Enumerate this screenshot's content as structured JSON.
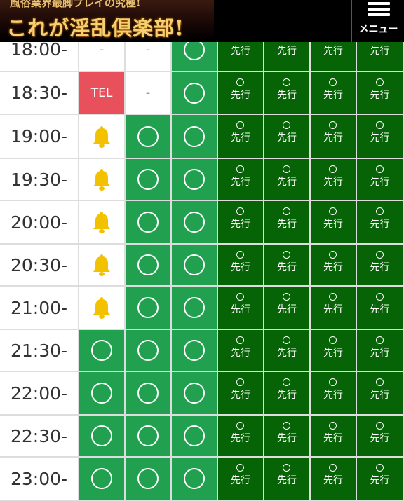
{
  "header": {
    "banner_top": "風俗業界最脚プレイの究極!",
    "banner_main": "これが淫乱倶楽部!",
    "menu_label": "メニュー"
  },
  "colors": {
    "light_green": "#21a050",
    "dark_green": "#066306",
    "tel_red": "#e8505c",
    "bell_yellow": "#f2c200"
  },
  "schedule": {
    "rows": [
      {
        "time": "18:00-",
        "cells": [
          "dash",
          "dash",
          "open",
          "sen",
          "sen",
          "sen",
          "sen"
        ]
      },
      {
        "time": "18:30-",
        "cells": [
          "tel",
          "dash",
          "open",
          "sen",
          "sen",
          "sen",
          "sen"
        ]
      },
      {
        "time": "19:00-",
        "cells": [
          "bell",
          "open",
          "open",
          "sen",
          "sen",
          "sen",
          "sen"
        ]
      },
      {
        "time": "19:30-",
        "cells": [
          "bell",
          "open",
          "open",
          "sen",
          "sen",
          "sen",
          "sen"
        ]
      },
      {
        "time": "20:00-",
        "cells": [
          "bell",
          "open",
          "open",
          "sen",
          "sen",
          "sen",
          "sen"
        ]
      },
      {
        "time": "20:30-",
        "cells": [
          "bell",
          "open",
          "open",
          "sen",
          "sen",
          "sen",
          "sen"
        ]
      },
      {
        "time": "21:00-",
        "cells": [
          "bell",
          "open",
          "open",
          "sen",
          "sen",
          "sen",
          "sen"
        ]
      },
      {
        "time": "21:30-",
        "cells": [
          "open",
          "open",
          "open",
          "sen",
          "sen",
          "sen",
          "sen"
        ]
      },
      {
        "time": "22:00-",
        "cells": [
          "open",
          "open",
          "open",
          "sen",
          "sen",
          "sen",
          "sen"
        ]
      },
      {
        "time": "22:30-",
        "cells": [
          "open",
          "open",
          "open",
          "sen",
          "sen",
          "sen",
          "sen"
        ]
      },
      {
        "time": "23:00-",
        "cells": [
          "open",
          "open",
          "open",
          "sen",
          "sen",
          "sen",
          "sen"
        ]
      }
    ],
    "labels": {
      "dash": "-",
      "tel": "TEL",
      "sen": "先行"
    },
    "icons": {
      "bell": "bell-icon",
      "open": "circle-icon",
      "sen": "small-circle-icon"
    }
  }
}
